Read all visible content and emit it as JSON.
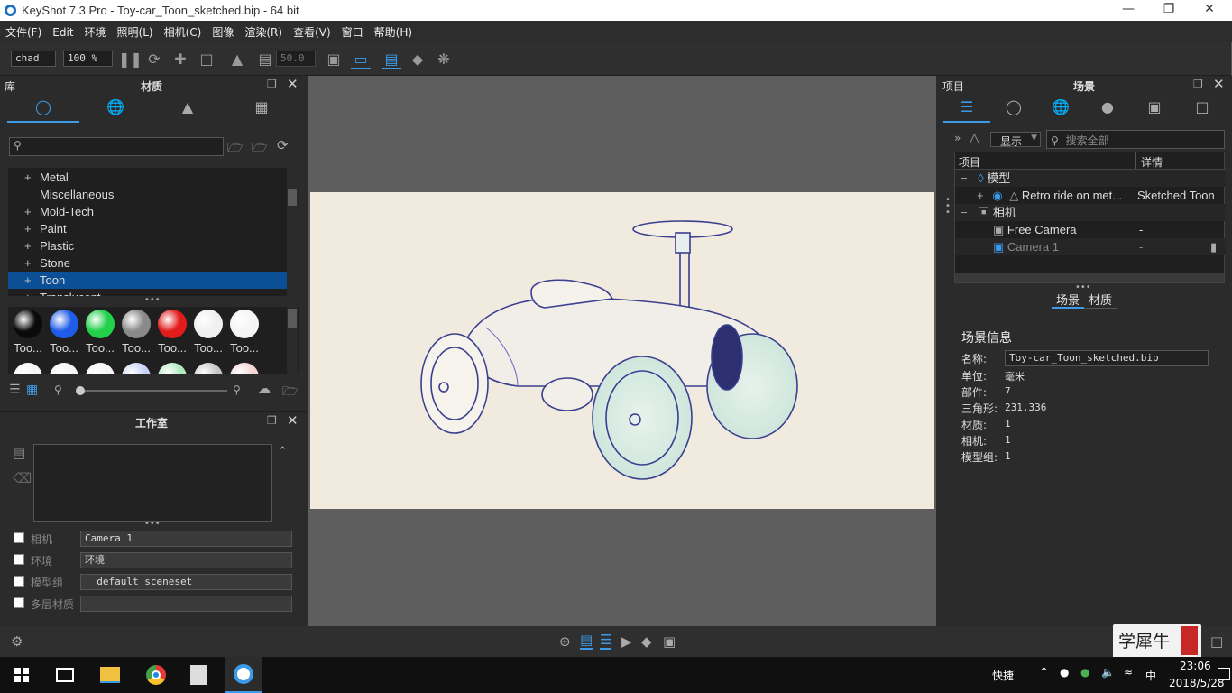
{
  "window": {
    "title": "KeyShot 7.3 Pro  - Toy-car_Toon_sketched.bip  - 64 bit"
  },
  "menu": [
    "文件(F)",
    "Edit",
    "环境",
    "照明(L)",
    "相机(C)",
    "图像",
    "渲染(R)",
    "查看(V)",
    "窗口",
    "帮助(H)"
  ],
  "toolbar": {
    "preset": "chad",
    "zoom": "100 %",
    "value": "50.0"
  },
  "library": {
    "label": "库",
    "title": "材质",
    "categories": [
      "Metal",
      "Miscellaneous",
      "Mold-Tech",
      "Paint",
      "Plastic",
      "Stone",
      "Toon",
      "Translucent"
    ],
    "selected": "Toon",
    "swatch_label": "Too...",
    "swatch_colors": [
      "#0a0a0a",
      "#1f5de8",
      "#22d04a",
      "#8a8a8a",
      "#e21c1c",
      "#f0f0f0",
      "#f5f5f5"
    ],
    "swatch_colors_row2": [
      "#f5f5f5",
      "#f5f5f5",
      "#f5f5f5",
      "#c8d2f5",
      "#b0e8c0",
      "#c5c5c5",
      "#f3d3d3"
    ]
  },
  "studio": {
    "title": "工作室",
    "rows": [
      {
        "label": "相机",
        "value": "Camera 1"
      },
      {
        "label": "环境",
        "value": "环境"
      },
      {
        "label": "模型组",
        "value": "__default_sceneset__"
      },
      {
        "label": "多层材质",
        "value": ""
      }
    ]
  },
  "project": {
    "label": "项目",
    "title": "场景",
    "display_label": "显示",
    "search_placeholder": "搜索全部",
    "columns": [
      "项目",
      "详情"
    ],
    "tree": {
      "model_group": "模型",
      "model_item": "Retro ride on met...",
      "model_detail": "Sketched Toon",
      "camera_group": "相机",
      "cam1": "Free Camera",
      "cam1_detail": "-",
      "cam2": "Camera 1",
      "cam2_detail": "-"
    },
    "subtabs": [
      "场景",
      "材质"
    ],
    "info_title": "场景信息",
    "info": {
      "name_label": "名称:",
      "name_value": "Toy-car_Toon_sketched.bip",
      "rows": [
        {
          "label": "单位:",
          "value": "毫米"
        },
        {
          "label": "部件:",
          "value": "7"
        },
        {
          "label": "三角形:",
          "value": "231,336"
        },
        {
          "label": "材质:",
          "value": "1"
        },
        {
          "label": "相机:",
          "value": "1"
        },
        {
          "label": "模型组:",
          "value": "1"
        }
      ]
    }
  },
  "taskbar": {
    "quick": "快捷",
    "ime": "中",
    "time": "23:06",
    "date": "2018/5/28"
  },
  "watermark": "学犀牛"
}
